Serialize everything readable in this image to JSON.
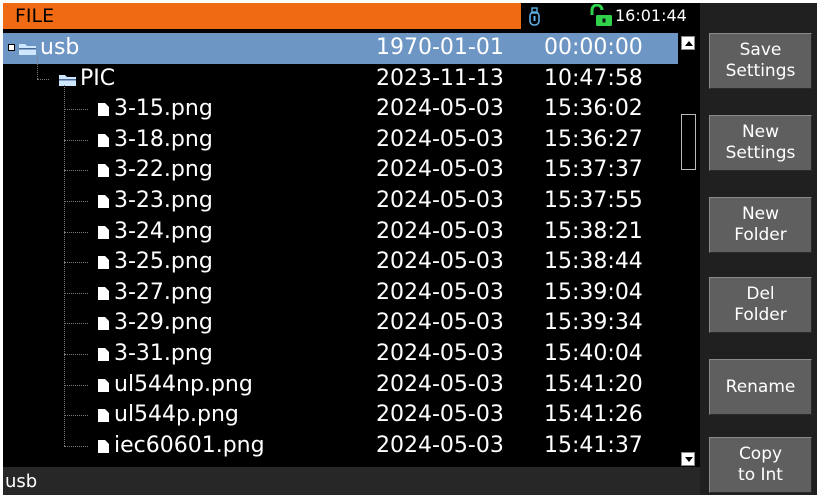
{
  "titlebar": {
    "title": "FILE",
    "clock": "16:01:44",
    "usb_icon": "usb-drive-icon",
    "lock_icon": "unlocked-padlock-icon",
    "lock_color": "#2fd24a",
    "title_color": "#ef6a12"
  },
  "files": [
    {
      "name": "usb",
      "date": "1970-01-01",
      "time": "00:00:00",
      "kind": "folder",
      "level": 0,
      "selected": true
    },
    {
      "name": "PIC",
      "date": "2023-11-13",
      "time": "10:47:58",
      "kind": "folder",
      "level": 1,
      "selected": false
    },
    {
      "name": "3-15.png",
      "date": "2024-05-03",
      "time": "15:36:02",
      "kind": "file",
      "level": 2
    },
    {
      "name": "3-18.png",
      "date": "2024-05-03",
      "time": "15:36:27",
      "kind": "file",
      "level": 2
    },
    {
      "name": "3-22.png",
      "date": "2024-05-03",
      "time": "15:37:37",
      "kind": "file",
      "level": 2
    },
    {
      "name": "3-23.png",
      "date": "2024-05-03",
      "time": "15:37:55",
      "kind": "file",
      "level": 2
    },
    {
      "name": "3-24.png",
      "date": "2024-05-03",
      "time": "15:38:21",
      "kind": "file",
      "level": 2
    },
    {
      "name": "3-25.png",
      "date": "2024-05-03",
      "time": "15:38:44",
      "kind": "file",
      "level": 2
    },
    {
      "name": "3-27.png",
      "date": "2024-05-03",
      "time": "15:39:04",
      "kind": "file",
      "level": 2
    },
    {
      "name": "3-29.png",
      "date": "2024-05-03",
      "time": "15:39:34",
      "kind": "file",
      "level": 2
    },
    {
      "name": "3-31.png",
      "date": "2024-05-03",
      "time": "15:40:04",
      "kind": "file",
      "level": 2
    },
    {
      "name": "ul544np.png",
      "date": "2024-05-03",
      "time": "15:41:20",
      "kind": "file",
      "level": 2
    },
    {
      "name": "ul544p.png",
      "date": "2024-05-03",
      "time": "15:41:26",
      "kind": "file",
      "level": 2
    },
    {
      "name": "iec60601.png",
      "date": "2024-05-03",
      "time": "15:41:37",
      "kind": "file",
      "level": 2
    }
  ],
  "softkeys": [
    {
      "line1": "Save",
      "line2": "Settings"
    },
    {
      "line1": "New",
      "line2": "Settings"
    },
    {
      "line1": "New",
      "line2": "Folder"
    },
    {
      "line1": "Del",
      "line2": "Folder"
    },
    {
      "line1": "Rename",
      "line2": ""
    },
    {
      "line1": "Copy",
      "line2": "to Int"
    }
  ],
  "statusbar": {
    "path": "usb"
  },
  "colors": {
    "selection": "#6e96c4",
    "folder_icon": "#cfe6ff",
    "softkey_bg": "#5f5f5f"
  }
}
